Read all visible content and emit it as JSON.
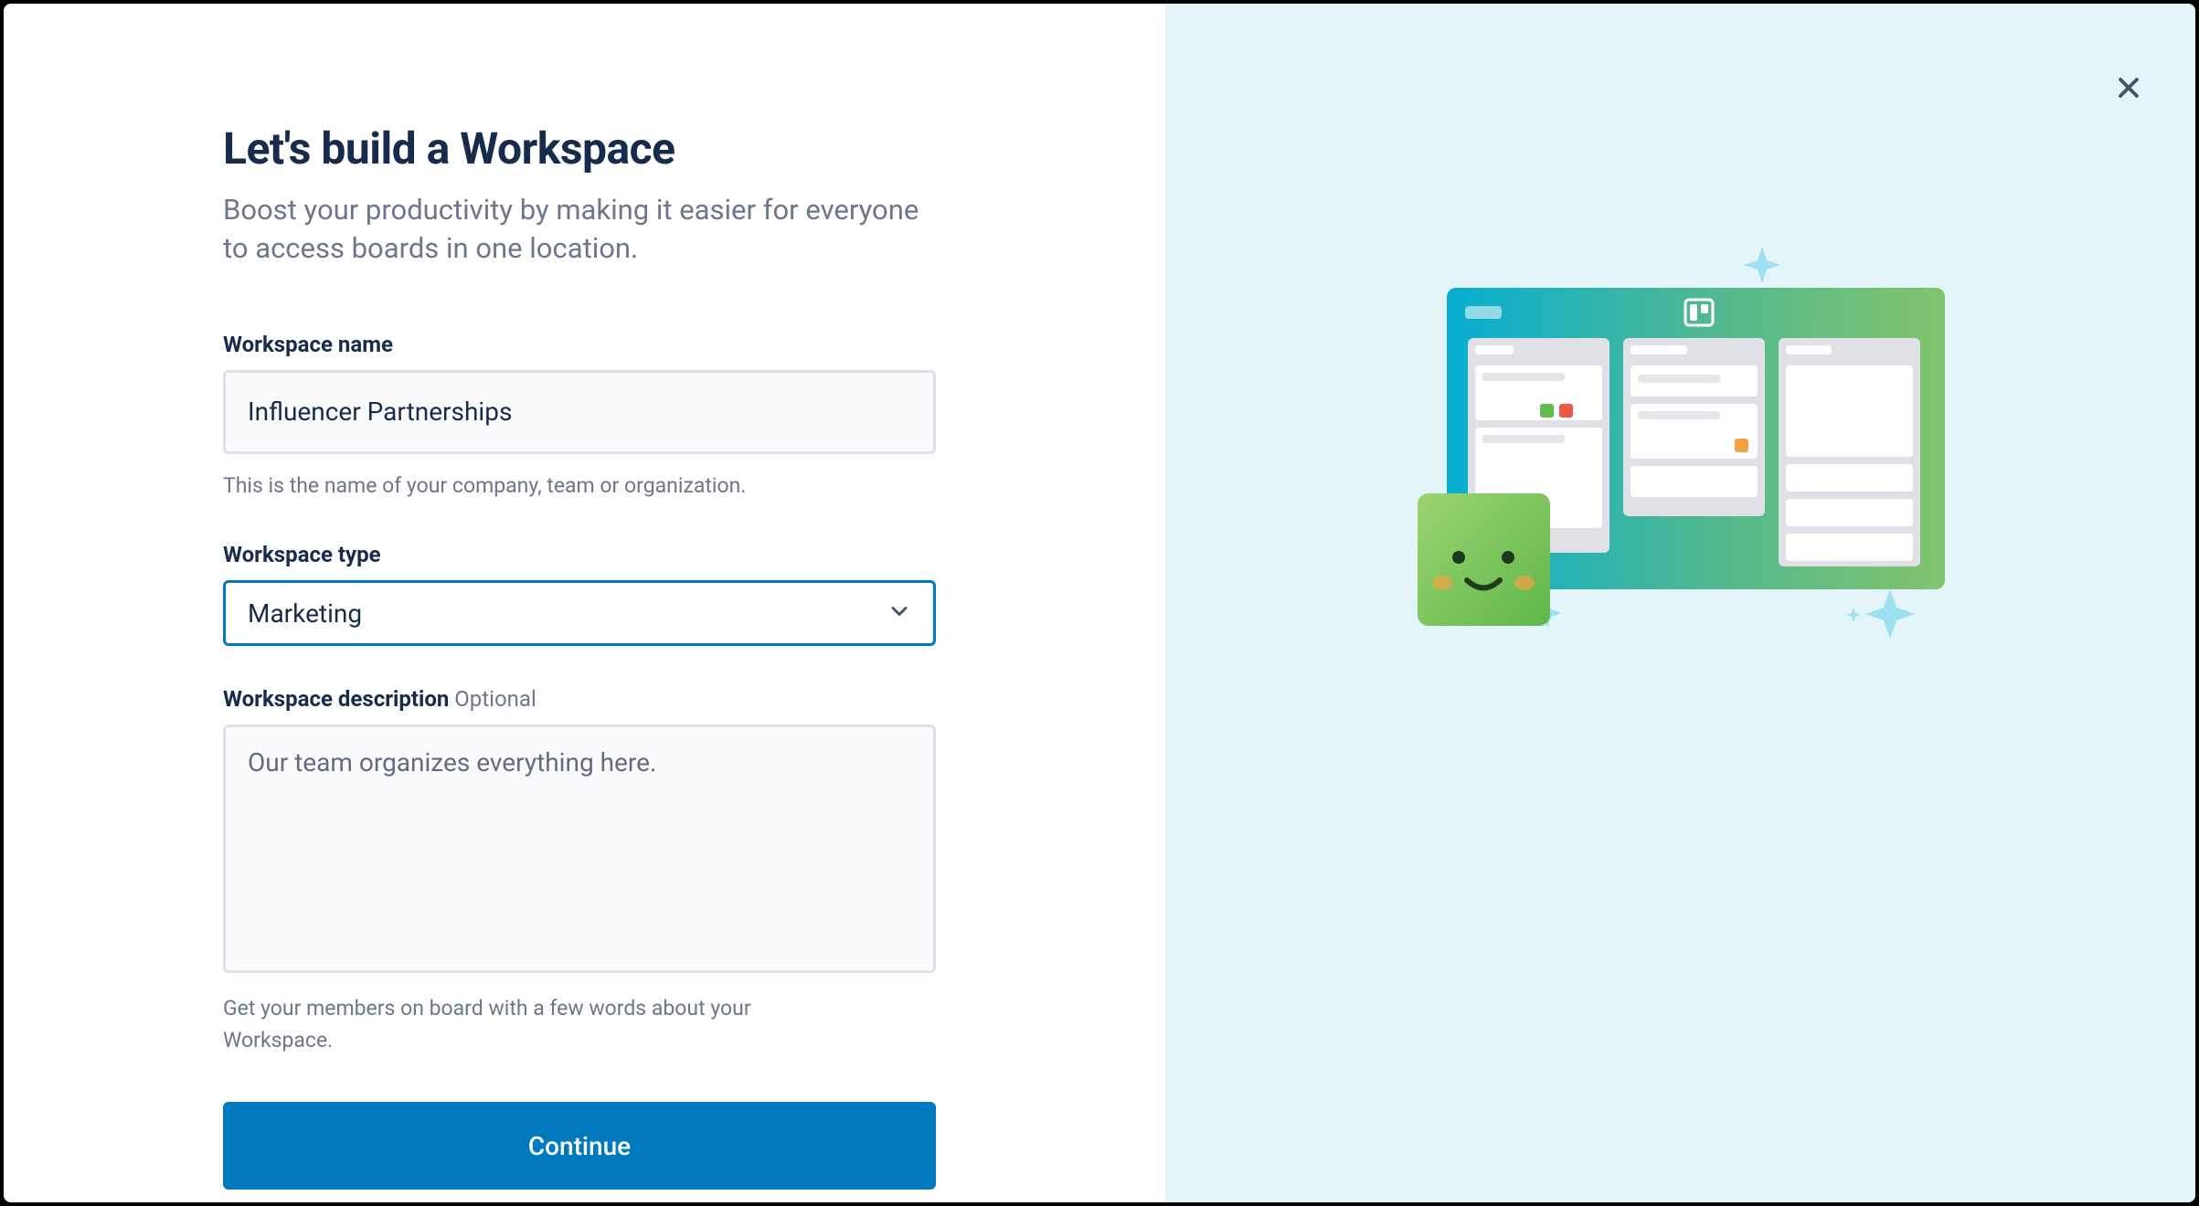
{
  "modal": {
    "heading": "Let's build a Workspace",
    "subheading": "Boost your productivity by making it easier for everyone to access boards in one location."
  },
  "fields": {
    "name": {
      "label": "Workspace name",
      "value": "Influencer Partnerships",
      "helper": "This is the name of your company, team or organization."
    },
    "type": {
      "label": "Workspace type",
      "value": "Marketing"
    },
    "description": {
      "label": "Workspace description",
      "optional_label": "Optional",
      "placeholder": "Our team organizes everything here.",
      "value": "",
      "helper": "Get your members on board with a few words about your Workspace."
    }
  },
  "buttons": {
    "continue": "Continue"
  }
}
